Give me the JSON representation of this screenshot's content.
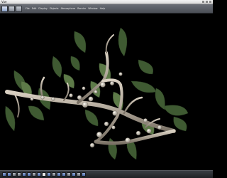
{
  "window": {
    "title": "Vue"
  },
  "toolbar": {
    "menus": [
      "File",
      "Edit",
      "Display",
      "Objects",
      "Atmosphere",
      "Render",
      "Window",
      "Help"
    ]
  },
  "statusbar": {
    "icons": [
      "render-icon",
      "select-icon",
      "move-icon",
      "rotate-icon",
      "scale-icon",
      "camera-icon",
      "light-icon",
      "grid-icon",
      "zoom-icon",
      "pan-icon",
      "orbit-icon",
      "frame-icon",
      "layer-icon",
      "material-icon",
      "view-icon",
      "settings-icon",
      "help-icon"
    ]
  },
  "colors": {
    "background": "#000000",
    "branch": "#b5aa9a",
    "leaf": "#4f6a3e",
    "blossom": "#d9d4c8"
  }
}
